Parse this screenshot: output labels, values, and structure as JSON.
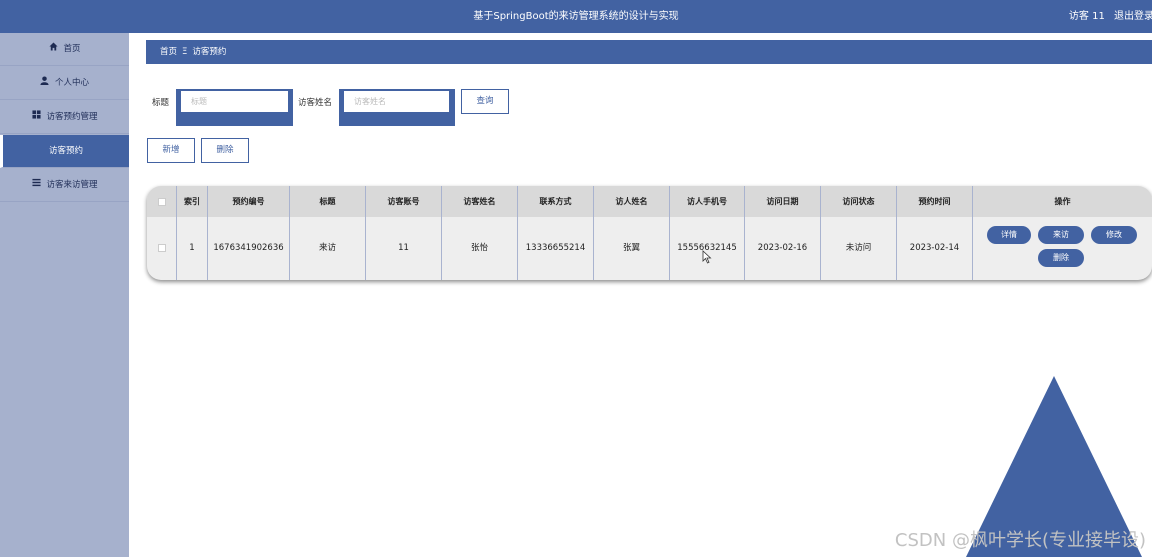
{
  "header": {
    "title": "基于SpringBoot的来访管理系统的设计与实现",
    "user_label": "访客 11",
    "logout_label": "退出登录"
  },
  "sidebar": {
    "items": [
      {
        "label": "首页",
        "icon": "home-icon"
      },
      {
        "label": "个人中心",
        "icon": "user-icon"
      },
      {
        "label": "访客预约管理",
        "icon": "grid-icon"
      },
      {
        "label": "访客预约",
        "icon": ""
      },
      {
        "label": "访客来访管理",
        "icon": "list-icon"
      }
    ]
  },
  "breadcrumb": {
    "home": "首页",
    "separator": "Ξ",
    "current": "访客预约"
  },
  "search": {
    "title_label": "标题",
    "title_placeholder": "标题",
    "name_label": "访客姓名",
    "name_placeholder": "访客姓名",
    "query_button": "查询"
  },
  "actions": {
    "add_button": "新增",
    "delete_button": "删除"
  },
  "table": {
    "headers": [
      "索引",
      "预约编号",
      "标题",
      "访客账号",
      "访客姓名",
      "联系方式",
      "访人姓名",
      "访人手机号",
      "访问日期",
      "访问状态",
      "预约时间",
      "操作"
    ],
    "rows": [
      {
        "cells": [
          "1",
          "1676341902636",
          "来访",
          "11",
          "张怡",
          "13336655214",
          "张翼",
          "15556632145",
          "2023-02-16",
          "未访问",
          "2023-02-14"
        ],
        "ops": [
          "详情",
          "来访",
          "修改",
          "删除"
        ]
      }
    ]
  },
  "decor": {
    "triangle_color": "#4262a2"
  },
  "watermark": "CSDN @枫叶学长(专业接毕设)"
}
